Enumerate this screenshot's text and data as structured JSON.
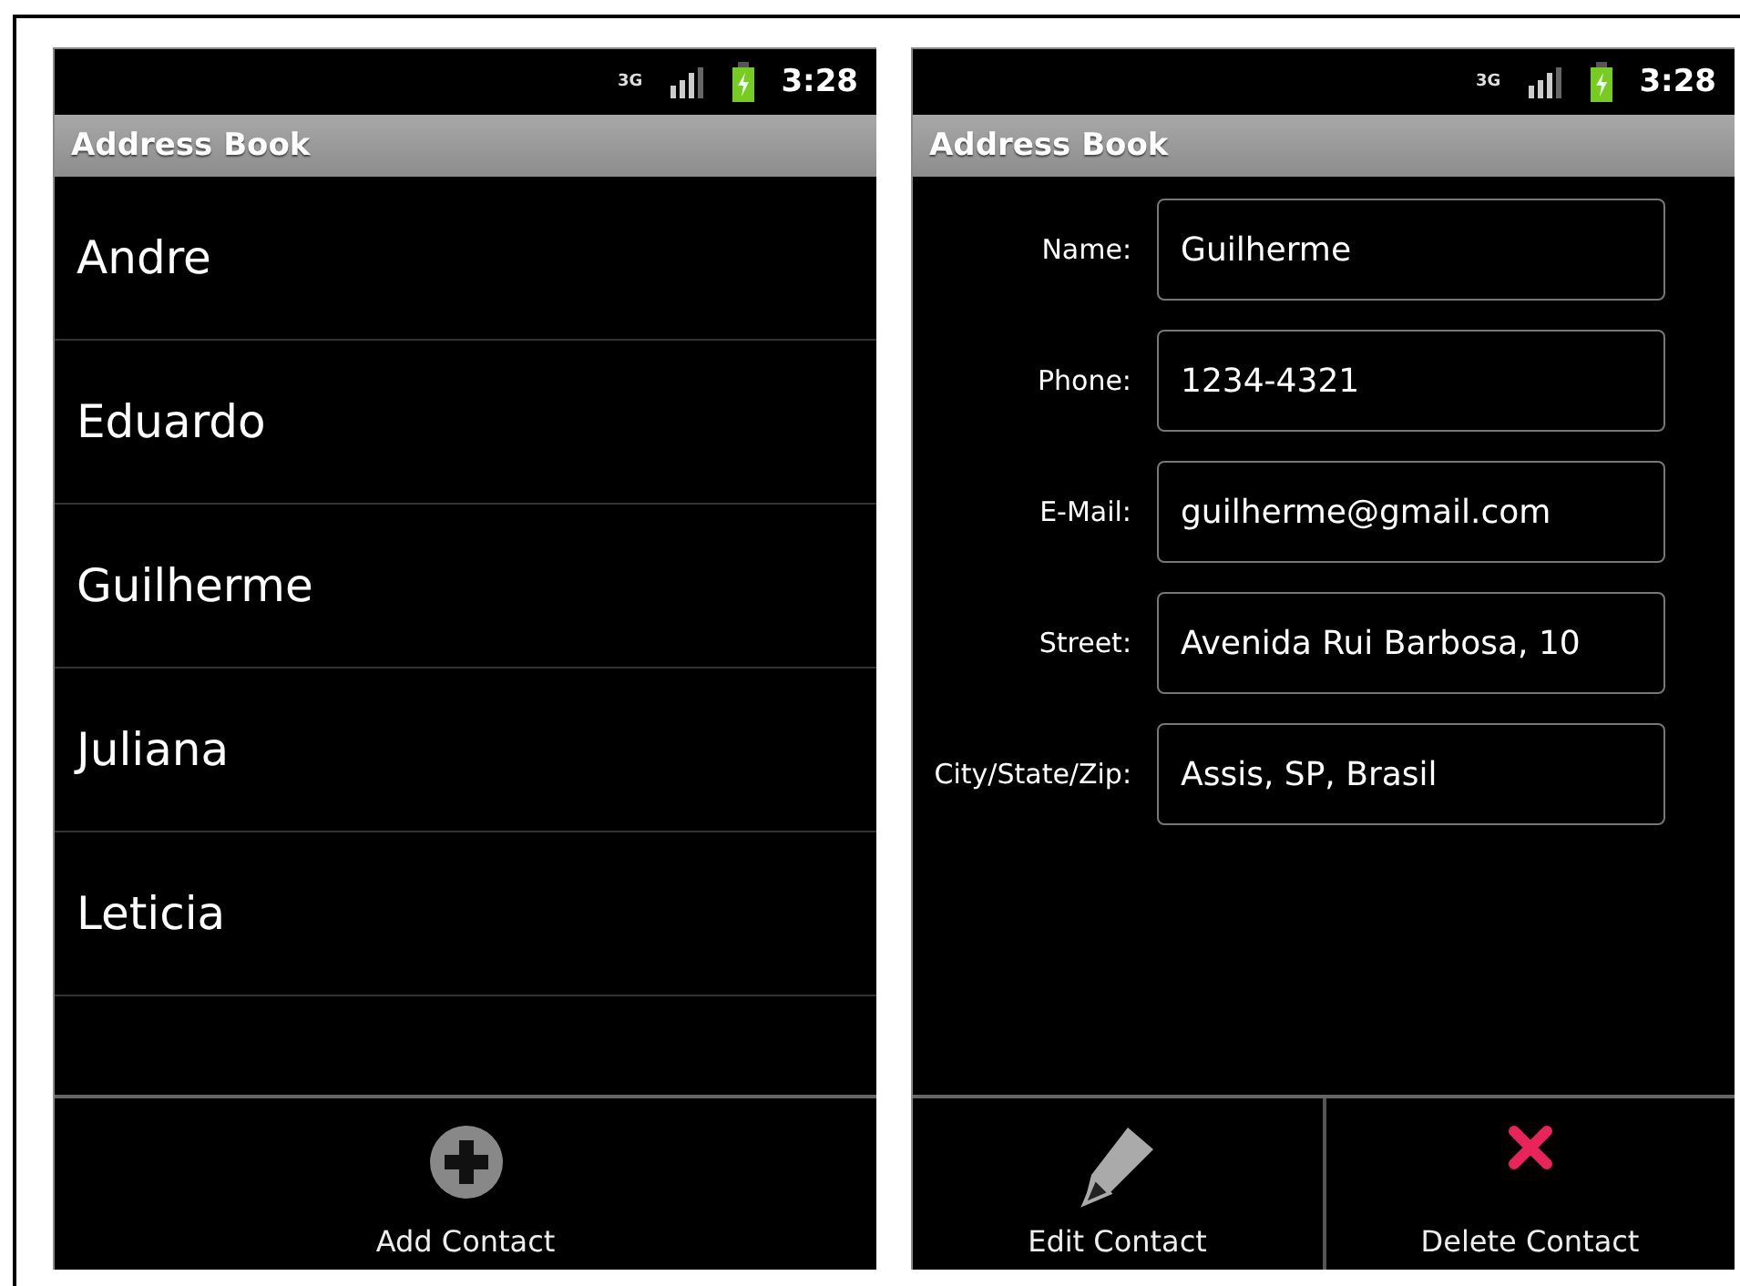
{
  "screens": [
    {
      "status": {
        "network": "3G",
        "time": "3:28"
      },
      "title": "Address Book",
      "kind": "list",
      "contacts": [
        {
          "name": "Andre"
        },
        {
          "name": "Eduardo"
        },
        {
          "name": "Guilherme"
        },
        {
          "name": "Juliana"
        },
        {
          "name": "Leticia"
        }
      ],
      "actions": [
        {
          "kind": "add",
          "label": "Add Contact"
        }
      ]
    },
    {
      "status": {
        "network": "3G",
        "time": "3:28"
      },
      "title": "Address Book",
      "kind": "form",
      "fields": [
        {
          "label": "Name:",
          "value": "Guilherme"
        },
        {
          "label": "Phone:",
          "value": "1234-4321"
        },
        {
          "label": "E-Mail:",
          "value": "guilherme@gmail.com"
        },
        {
          "label": "Street:",
          "value": "Avenida Rui Barbosa, 10"
        },
        {
          "label": "City/State/Zip:",
          "value": "Assis, SP, Brasil"
        }
      ],
      "actions": [
        {
          "kind": "edit",
          "label": "Edit Contact"
        },
        {
          "kind": "delete",
          "label": "Delete Contact"
        }
      ]
    }
  ]
}
